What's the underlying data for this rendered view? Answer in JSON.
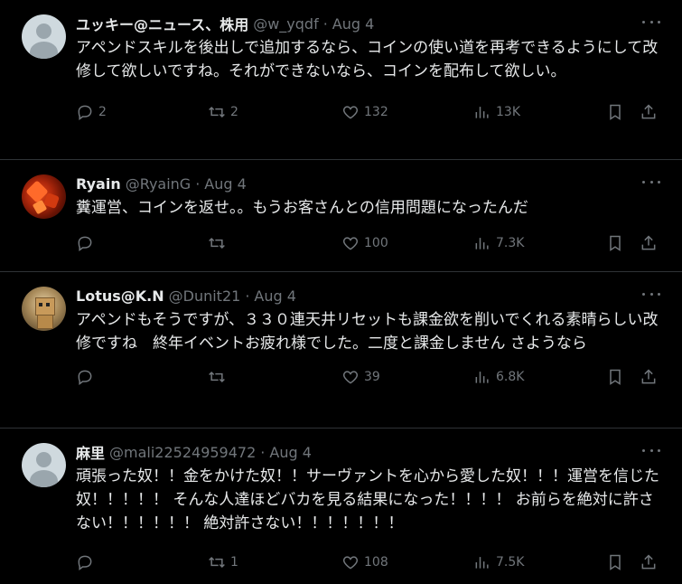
{
  "tweets": [
    {
      "name": "ユッキー@ニュース、株用",
      "handle": "@w_yqdf",
      "dot": "·",
      "date": "Aug 4",
      "avatar": "default-avatar",
      "text": "アペンドスキルを後出しで追加するなら、コインの使い道を再考できるようにして改修して欲しいですね。それができないなら、コインを配布して欲しい。",
      "replies": "2",
      "retweets": "2",
      "likes": "132",
      "views": "13K"
    },
    {
      "name": "Ryain",
      "handle": "@RyainG",
      "dot": "·",
      "date": "Aug 4",
      "avatar": "maple-avatar",
      "text": "糞運営、コインを返せ。。もうお客さんとの信用問題になったんだ",
      "replies": "",
      "retweets": "",
      "likes": "100",
      "views": "7.3K"
    },
    {
      "name": "Lotus@K.N",
      "handle": "@Dunit21",
      "dot": "·",
      "date": "Aug 4",
      "avatar": "danbo-avatar",
      "text": "アペンドもそうですが、３３０連天井リセットも課金欲を削いでくれる素晴らしい改修ですね　終年イベントお疲れ様でした。二度と課金しません さようなら",
      "replies": "",
      "retweets": "",
      "likes": "39",
      "views": "6.8K"
    },
    {
      "name": "麻里",
      "handle": "@mali22524959472",
      "dot": "·",
      "date": "Aug 4",
      "avatar": "default-avatar",
      "text": "頑張った奴！！金をかけた奴！！サーヴァントを心から愛した奴！！！運営を信じた奴！！！！！ そんな人達ほどバカを見る結果になった！！！！ お前らを絶対に許さない！！！！！！ 絶対許さない！！！！！！！",
      "replies": "",
      "retweets": "1",
      "likes": "108",
      "views": "7.5K"
    }
  ],
  "icons": [
    "more-icon",
    "reply-icon",
    "retweet-icon",
    "like-icon",
    "views-icon",
    "bookmark-icon",
    "share-icon"
  ],
  "colors": {
    "background": "#000000",
    "text": "#e7e9ea",
    "muted": "#71767b",
    "divider": "#2f3336"
  }
}
